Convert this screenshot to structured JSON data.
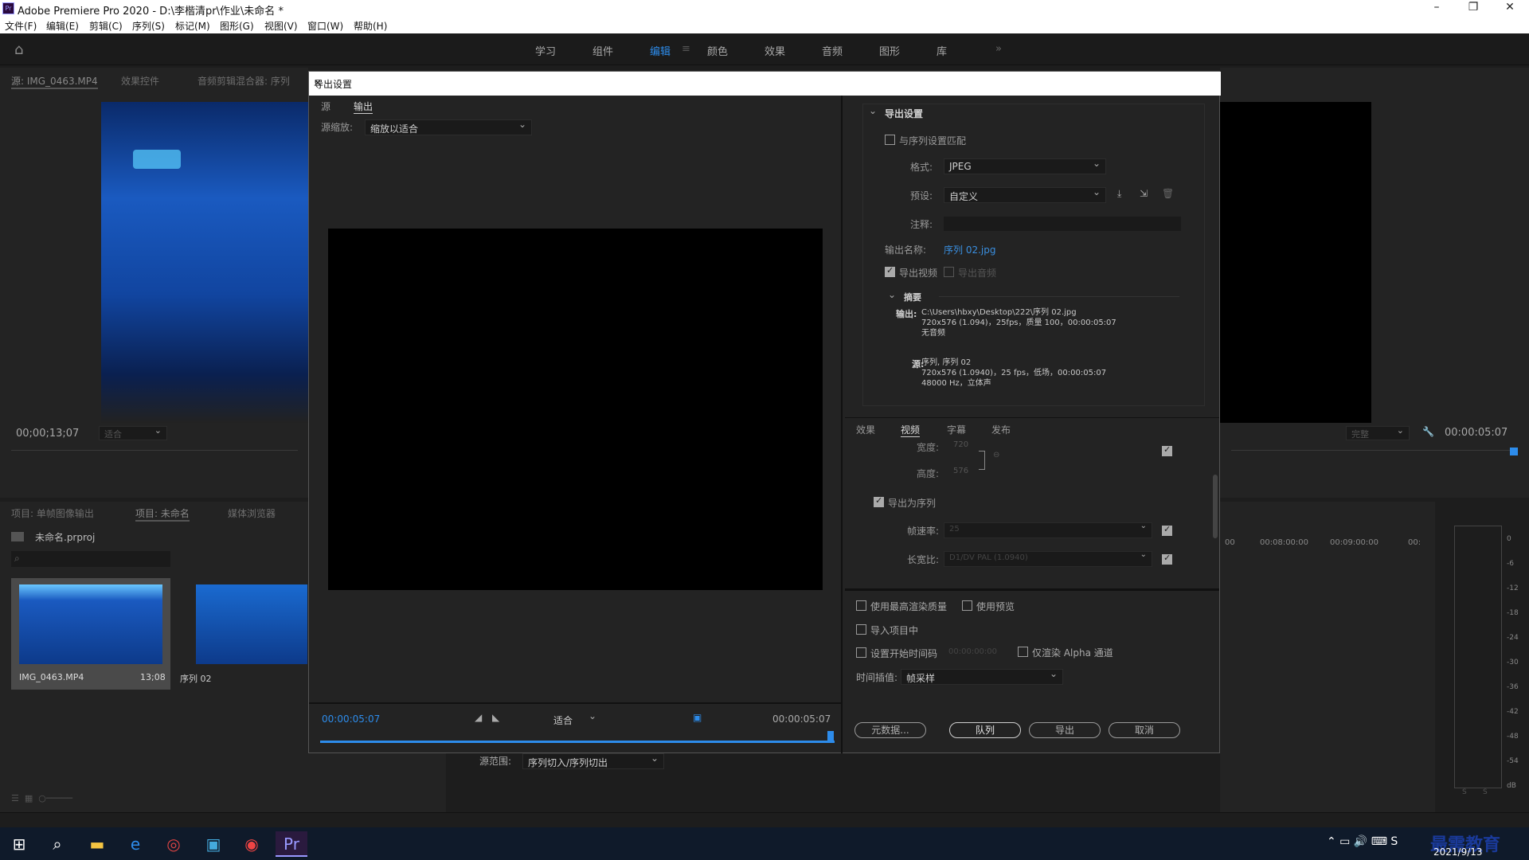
{
  "window": {
    "title": "Adobe Premiere Pro 2020 - D:\\李楷清pr\\作业\\未命名 *",
    "logo": "Pr"
  },
  "menu": [
    "文件(F)",
    "编辑(E)",
    "剪辑(C)",
    "序列(S)",
    "标记(M)",
    "图形(G)",
    "视图(V)",
    "窗口(W)",
    "帮助(H)"
  ],
  "workspaces": [
    "学习",
    "组件",
    "编辑",
    "颜色",
    "效果",
    "音频",
    "图形",
    "库"
  ],
  "active_workspace": "编辑",
  "source_panel": {
    "tabs": [
      "源: IMG_0463.MP4",
      "效果控件",
      "音频剪辑混合器: 序列"
    ],
    "timecode": "00;00;13;07",
    "fit": "适合"
  },
  "project_panel": {
    "tabs": [
      "项目: 单帧图像输出",
      "项目: 未命名",
      "媒体浏览器"
    ],
    "file": "未命名.prproj",
    "items": [
      {
        "name": "IMG_0463.MP4",
        "duration": "13;08"
      },
      {
        "name": "序列 02",
        "duration": ""
      }
    ]
  },
  "program_panel": {
    "timecode": "00:00:05:07",
    "fit": "完整"
  },
  "timeline": {
    "ruler": [
      "00",
      "00:08:00:00",
      "00:09:00:00",
      "00:"
    ]
  },
  "meter": {
    "labels": [
      "0",
      "-6",
      "-12",
      "-18",
      "-24",
      "-30",
      "-36",
      "-42",
      "-48",
      "-54",
      "dB"
    ],
    "footer": [
      "S",
      "S"
    ]
  },
  "dialog": {
    "title": "导出设置",
    "close": "✕",
    "left_tabs": [
      "源",
      "输出"
    ],
    "active_left_tab": "输出",
    "source_scale_label": "源缩放:",
    "source_scale": "缩放以适合",
    "preview_start": "00:00:05:07",
    "preview_end": "00:00:05:07",
    "preview_fit": "适合",
    "range_label": "源范围:",
    "range": "序列切入/序列切出",
    "export_settings": {
      "header": "导出设置",
      "match_sequence": "与序列设置匹配",
      "format_label": "格式:",
      "format": "JPEG",
      "preset_label": "预设:",
      "preset": "自定义",
      "comment_label": "注释:",
      "output_name_label": "输出名称:",
      "output_name": "序列 02.jpg",
      "export_video": "导出视频",
      "export_audio": "导出音频",
      "summary_header": "摘要",
      "output_label": "输出:",
      "output_lines": [
        "C:\\Users\\hbxy\\Desktop\\222\\序列 02.jpg",
        "720x576 (1.094)，25fps，质量 100，00:00:05:07",
        "无音频"
      ],
      "source_label": "源:",
      "source_lines": [
        "序列, 序列 02",
        "720x576 (1.0940)，25 fps，低场，00:00:05:07",
        "48000 Hz，立体声"
      ]
    },
    "right_tabs": [
      "效果",
      "视频",
      "字幕",
      "发布"
    ],
    "active_right_tab": "视频",
    "video": {
      "width_label": "宽度:",
      "width": "720",
      "height_label": "高度:",
      "height": "576",
      "export_as_sequence": "导出为序列",
      "fps_label": "帧速率:",
      "fps": "25",
      "aspect_label": "长宽比:",
      "aspect": "D1/DV PAL (1.0940)"
    },
    "options": {
      "max_quality": "使用最高渲染质量",
      "use_previews": "使用预览",
      "import_project": "导入项目中",
      "set_timecode": "设置开始时间码",
      "timecode_value": "00:00:00:00",
      "alpha_only": "仅渲染 Alpha 通道",
      "interp_label": "时间插值:",
      "interp": "帧采样"
    },
    "buttons": {
      "metadata": "元数据...",
      "queue": "队列",
      "export": "导出",
      "cancel": "取消"
    }
  },
  "taskbar": {
    "time": "",
    "date": "2021/9/13",
    "watermark": "最需教育"
  }
}
